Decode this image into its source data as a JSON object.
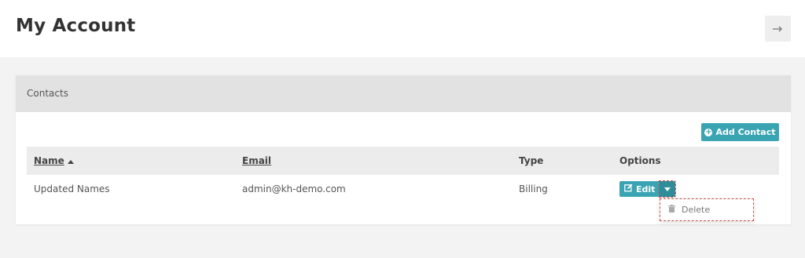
{
  "header": {
    "title": "My Account",
    "logout_icon": "arrow-right-icon"
  },
  "panel": {
    "title": "Contacts",
    "add_button_label": "Add Contact",
    "add_button_icon": "plus-circle-icon"
  },
  "table": {
    "columns": [
      {
        "label": "Name",
        "sortable": true,
        "sort": "asc"
      },
      {
        "label": "Email",
        "sortable": true
      },
      {
        "label": "Type",
        "sortable": false
      },
      {
        "label": "Options",
        "sortable": false
      }
    ],
    "rows": [
      {
        "name": "Updated Names",
        "email": "admin@kh-demo.com",
        "type": "Billing",
        "edit_label": "Edit"
      }
    ]
  },
  "dropdown": {
    "items": [
      {
        "label": "Delete",
        "icon": "trash-icon"
      }
    ]
  },
  "colors": {
    "accent": "#3ba4b3",
    "accent_dark": "#2f8d9a",
    "highlight": "#c84a4a"
  }
}
